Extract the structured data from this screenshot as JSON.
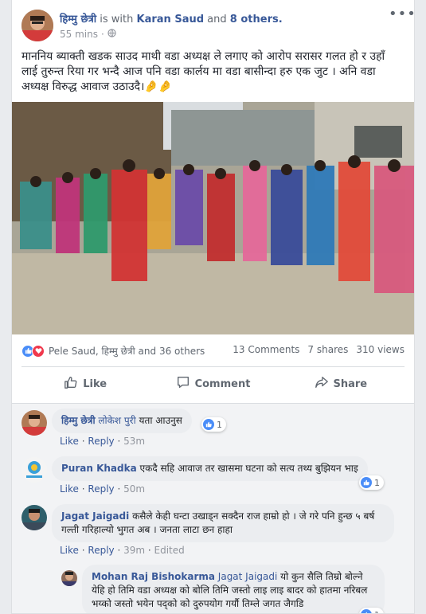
{
  "post": {
    "author": "हिम्मु छेत्री",
    "with_text": "is with",
    "tagged_person": "Karan Saud",
    "and_text": "and",
    "others": "8 others.",
    "time": "55 mins",
    "separator": "·",
    "privacy_icon": "globe-icon",
    "body": "माननिय ब्याक्ती खडक साउद माथी वडा अध्यक्ष ले लगाए को आरोप सरासर गलत हो र उहाँ लाई तुरुन्त रिया गर भन्दै आज पनि वडा कार्लय मा वडा बासीन्दा हरु एक जुट । अनि वडा अध्यक्ष विरुद्ध आवाज उठाउदै।🤌🤌"
  },
  "stats": {
    "reactors": "Pele Saud, हिम्मु छेत्री and 36 others",
    "comments": "13 Comments",
    "shares": "7 shares",
    "views": "310 views"
  },
  "actions": {
    "like": "Like",
    "comment": "Comment",
    "share": "Share"
  },
  "comments": [
    {
      "name": "हिम्मु छेत्री",
      "tag": "लोकेश पुरी",
      "text": "यता आउनुस",
      "like": "Like",
      "reply": "Reply",
      "time": "53m",
      "edited": "",
      "reactions": "1"
    },
    {
      "name": "Puran Khadka",
      "tag": "",
      "text": "एकदै सहि आवाज तर खासमा घटना को सत्य तथ्य बुझियन भाइ",
      "like": "Like",
      "reply": "Reply",
      "time": "50m",
      "edited": "",
      "reactions": "1"
    },
    {
      "name": "Jagat Jaigadi",
      "tag": "",
      "text": "कसैले केही घन्टा उखाड्न सक्दैन राज हाम्रो हो । जे गरे पनि हुन्छ ५ बर्ष गल्ती गरिहाल्यो भुगत अब । जनता लाटा छन हाहा",
      "like": "Like",
      "reply": "Reply",
      "time": "39m",
      "edited": "Edited",
      "reactions": ""
    },
    {
      "name": "Mohan Raj Bishokarma",
      "tag": "Jagat Jaigadi",
      "text": "यो कुन सैलि तिम्रो बोल्ने येहि हो तिमि वडा अध्यक्ष को बोलि तिमि जस्तो लाइ लाइ बादर को हातमा नरिबल भय्को जस्तो भयेन पद्को को दुरुपयोग गर्यौ तिम्ले जगत जैगडि",
      "reactions": "1"
    }
  ],
  "colors": {
    "link": "#385898",
    "like_blue": "#4a8df8",
    "love_red": "#f0394d",
    "bubble": "#ebedf0"
  }
}
